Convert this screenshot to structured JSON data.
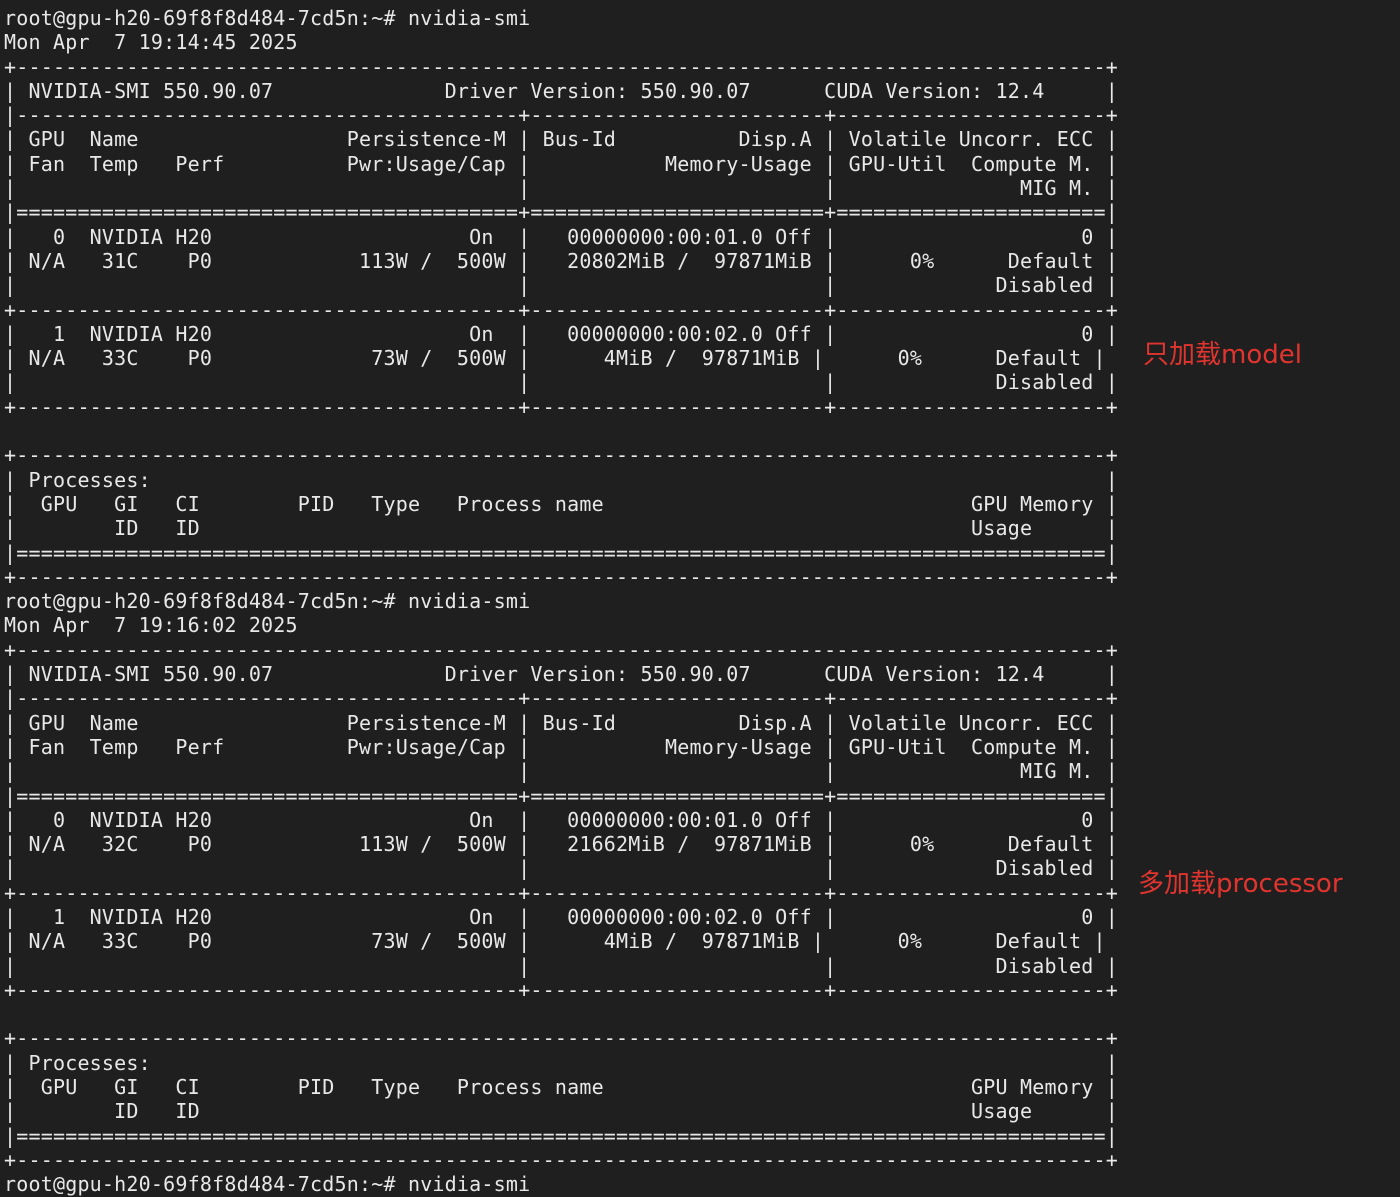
{
  "colors": {
    "background": "#1f1f1f",
    "text": "#e8e8e8",
    "annotation": "#e0342f"
  },
  "terminal": {
    "lines": [
      "root@gpu-h20-69f8f8d484-7cd5n:~# nvidia-smi",
      "Mon Apr  7 19:14:45 2025",
      "+-----------------------------------------------------------------------------------------+",
      "| NVIDIA-SMI 550.90.07              Driver Version: 550.90.07      CUDA Version: 12.4     |",
      "|-----------------------------------------+------------------------+----------------------+",
      "| GPU  Name                 Persistence-M | Bus-Id          Disp.A | Volatile Uncorr. ECC |",
      "| Fan  Temp   Perf          Pwr:Usage/Cap |           Memory-Usage | GPU-Util  Compute M. |",
      "|                                         |                        |               MIG M. |",
      "|=========================================+========================+======================|",
      "|   0  NVIDIA H20                     On  |   00000000:00:01.0 Off |                    0 |",
      "| N/A   31C    P0            113W /  500W |   20802MiB /  97871MiB |      0%      Default |",
      "|                                         |                        |             Disabled |",
      "+-----------------------------------------+------------------------+----------------------+",
      "|   1  NVIDIA H20                     On  |   00000000:00:02.0 Off |                    0 |",
      "| N/A   33C    P0             73W /  500W |      4MiB /  97871MiB |      0%      Default |",
      "|                                         |                        |             Disabled |",
      "+-----------------------------------------+------------------------+----------------------+",
      "",
      "+-----------------------------------------------------------------------------------------+",
      "| Processes:                                                                              |",
      "|  GPU   GI   CI        PID   Type   Process name                              GPU Memory |",
      "|        ID   ID                                                               Usage      |",
      "|=========================================================================================|",
      "+-----------------------------------------------------------------------------------------+",
      "root@gpu-h20-69f8f8d484-7cd5n:~# nvidia-smi",
      "Mon Apr  7 19:16:02 2025",
      "+-----------------------------------------------------------------------------------------+",
      "| NVIDIA-SMI 550.90.07              Driver Version: 550.90.07      CUDA Version: 12.4     |",
      "|-----------------------------------------+------------------------+----------------------+",
      "| GPU  Name                 Persistence-M | Bus-Id          Disp.A | Volatile Uncorr. ECC |",
      "| Fan  Temp   Perf          Pwr:Usage/Cap |           Memory-Usage | GPU-Util  Compute M. |",
      "|                                         |                        |               MIG M. |",
      "|=========================================+========================+======================|",
      "|   0  NVIDIA H20                     On  |   00000000:00:01.0 Off |                    0 |",
      "| N/A   32C    P0            113W /  500W |   21662MiB /  97871MiB |      0%      Default |",
      "|                                         |                        |             Disabled |",
      "+-----------------------------------------+------------------------+----------------------+",
      "|   1  NVIDIA H20                     On  |   00000000:00:02.0 Off |                    0 |",
      "| N/A   33C    P0             73W /  500W |      4MiB /  97871MiB |      0%      Default |",
      "|                                         |                        |             Disabled |",
      "+-----------------------------------------+------------------------+----------------------+",
      "",
      "+-----------------------------------------------------------------------------------------+",
      "| Processes:                                                                              |",
      "|  GPU   GI   CI        PID   Type   Process name                              GPU Memory |",
      "|        ID   ID                                                               Usage      |",
      "|=========================================================================================|",
      "+-----------------------------------------------------------------------------------------+",
      "root@gpu-h20-69f8f8d484-7cd5n:~# nvidia-smi"
    ]
  },
  "annotations": {
    "first": "只加载model",
    "second": "多加载processor"
  }
}
